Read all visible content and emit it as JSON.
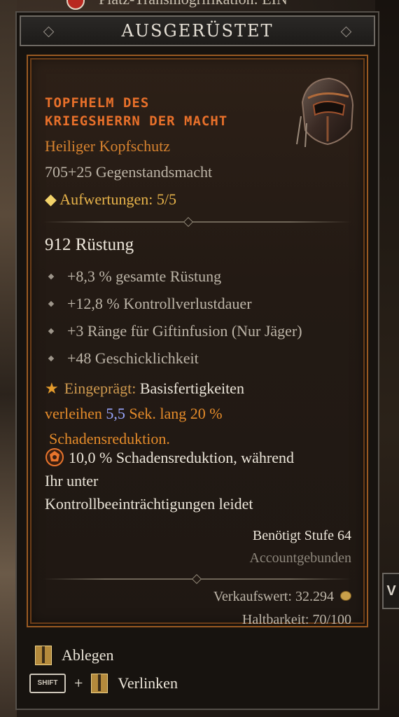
{
  "top_strip": "Platz-Transmogrifikation: EIN",
  "side_button": "V",
  "header": {
    "title": "AUSGERÜSTET"
  },
  "item": {
    "name_line1": "TOPFHELM DES",
    "name_line2": "KRIEGSHERRN DER MACHT",
    "type": "Heiliger Kopfschutz",
    "item_power": "705+25 Gegenstandsmacht",
    "upgrades": "Aufwertungen: 5/5",
    "armor": "912 Rüstung",
    "affixes": [
      "+8,3 % gesamte Rüstung",
      "+12,8 % Kontrollverlustdauer",
      "+3 Ränge für Giftinfusion (Nur Jäger)",
      "+48 Geschicklichkeit"
    ],
    "imprint": {
      "label": "Eingeprägt:",
      "part1": "Basisfertigkeiten",
      "part2": "verleihen",
      "value": "5,5",
      "part3": "Sek. lang 20 %",
      "part4": "Schadensreduktion."
    },
    "aspect": {
      "line1": "10,0 % Schadensreduktion, während",
      "line2": "Ihr unter",
      "line3": "Kontrollbeeinträchtigungen leidet"
    },
    "required_level": "Benötigt Stufe 64",
    "bound": "Accountgebunden",
    "sell_value": "Verkaufswert: 32.294",
    "durability": "Haltbarkeit: 70/100"
  },
  "footer": {
    "unequip": "Ablegen",
    "shift_key": "SHIFT",
    "plus": "+",
    "link": "Verlinken"
  },
  "colors": {
    "legendary_orange": "#e8702a",
    "frame_orange": "#9a5a22",
    "imprint_blue": "#9aa7ff",
    "gold": "#e7b34a"
  }
}
